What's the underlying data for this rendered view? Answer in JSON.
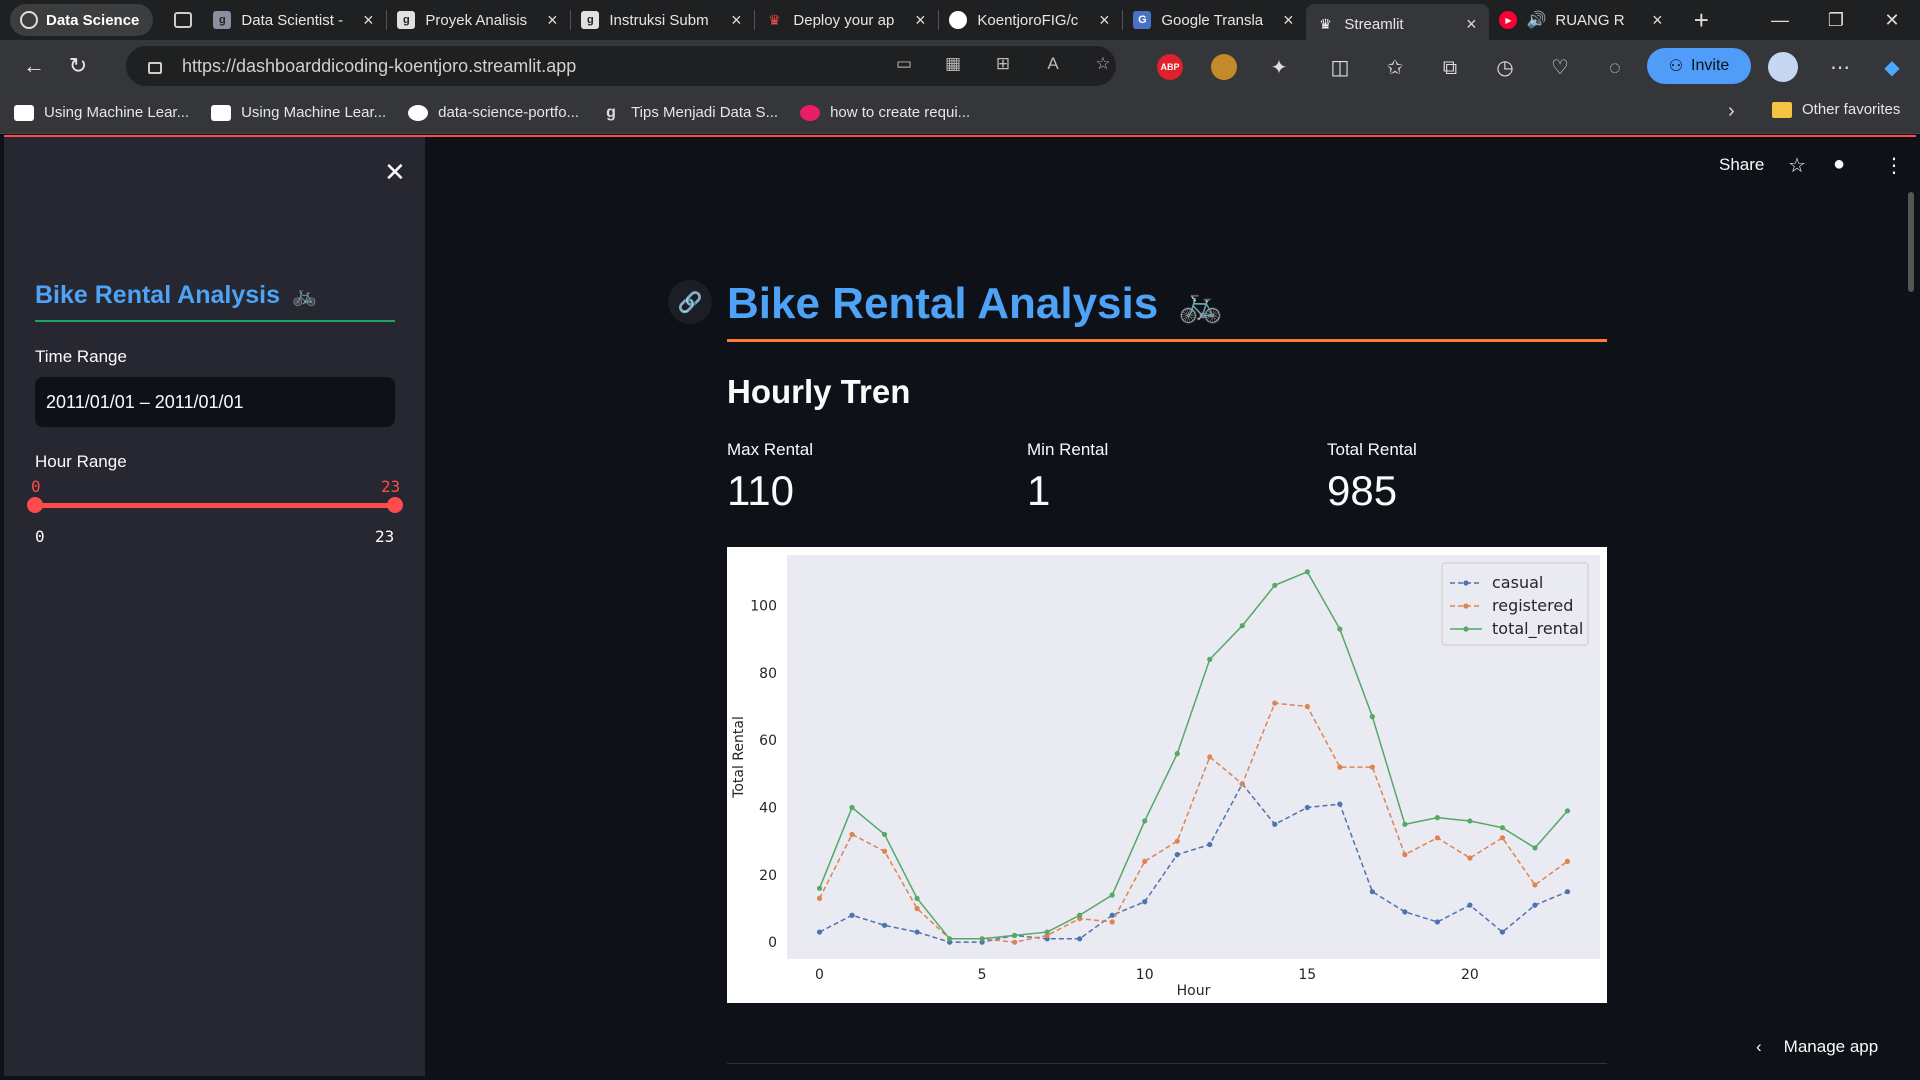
{
  "browser": {
    "tab_group": "Data Science",
    "tabs": [
      {
        "label": "Data Scientist -",
        "favicon": "g"
      },
      {
        "label": "Proyek Analisis",
        "favicon": "g"
      },
      {
        "label": "Instruksi Subm",
        "favicon": "g"
      },
      {
        "label": "Deploy your ap",
        "favicon": "crown"
      },
      {
        "label": "KoentjoroFIG/c",
        "favicon": "github"
      },
      {
        "label": "Google Transla",
        "favicon": "translate"
      },
      {
        "label": "Streamlit",
        "favicon": "crown",
        "active": true
      },
      {
        "label": "RUANG R",
        "favicon": "youtube"
      }
    ],
    "url": "https://dashboarddicoding-koentjoro.streamlit.app",
    "invite_label": "Invite",
    "extensions": {
      "abp_label": "ABP"
    },
    "bookmarks": [
      {
        "label": "Using Machine Lear...",
        "icon": "medium-icon"
      },
      {
        "label": "Using Machine Lear...",
        "icon": "medium-icon"
      },
      {
        "label": "data-science-portfo...",
        "icon": "github-icon"
      },
      {
        "label": "Tips Menjadi Data S...",
        "icon": "g-icon"
      },
      {
        "label": "how to create requi...",
        "icon": "pink-icon"
      }
    ],
    "other_favorites": "Other favorites"
  },
  "app": {
    "header": {
      "share_label": "Share"
    },
    "sidebar": {
      "title": "Bike Rental Analysis",
      "title_emoji": "🚲",
      "time_range_label": "Time Range",
      "time_range_value": "2011/01/01 – 2011/01/01",
      "hour_range_label": "Hour Range",
      "hour_min": "0",
      "hour_max": "23",
      "hour_tick_min": "0",
      "hour_tick_max": "23"
    },
    "main": {
      "title": "Bike Rental Analysis",
      "title_emoji": "🚲",
      "subheader": "Hourly Tren",
      "metrics": [
        {
          "label": "Max Rental",
          "value": "110"
        },
        {
          "label": "Min Rental",
          "value": "1"
        },
        {
          "label": "Total Rental",
          "value": "985"
        }
      ]
    },
    "manage_app_label": "Manage app"
  },
  "chart_data": {
    "type": "line",
    "xlabel": "Hour",
    "ylabel": "Total Rental",
    "xlim": [
      -1,
      24
    ],
    "ylim": [
      -5,
      115
    ],
    "xticks": [
      0,
      5,
      10,
      15,
      20
    ],
    "yticks": [
      0,
      20,
      40,
      60,
      80,
      100
    ],
    "grid": false,
    "legend_position": "top-right",
    "x": [
      0,
      1,
      2,
      3,
      4,
      5,
      6,
      7,
      8,
      9,
      10,
      11,
      12,
      13,
      14,
      15,
      16,
      17,
      18,
      19,
      20,
      21,
      22,
      23
    ],
    "series": [
      {
        "name": "casual",
        "color": "#4c72b0",
        "dashed": true,
        "values": [
          3,
          8,
          5,
          3,
          0,
          0,
          2,
          1,
          1,
          8,
          12,
          26,
          29,
          47,
          35,
          40,
          41,
          15,
          9,
          6,
          11,
          3,
          11,
          15
        ]
      },
      {
        "name": "registered",
        "color": "#dd8452",
        "dashed": true,
        "values": [
          13,
          32,
          27,
          10,
          1,
          1,
          0,
          2,
          7,
          6,
          24,
          30,
          55,
          47,
          71,
          70,
          52,
          52,
          26,
          31,
          25,
          31,
          17,
          24
        ]
      },
      {
        "name": "total_rental",
        "color": "#55a868",
        "dashed": false,
        "values": [
          16,
          40,
          32,
          13,
          1,
          1,
          2,
          3,
          8,
          14,
          36,
          56,
          84,
          94,
          106,
          110,
          93,
          67,
          35,
          37,
          36,
          34,
          28,
          39
        ]
      }
    ],
    "colors": {
      "plot_bg": "#eaeaf2",
      "fig_bg": "#ffffff"
    }
  }
}
